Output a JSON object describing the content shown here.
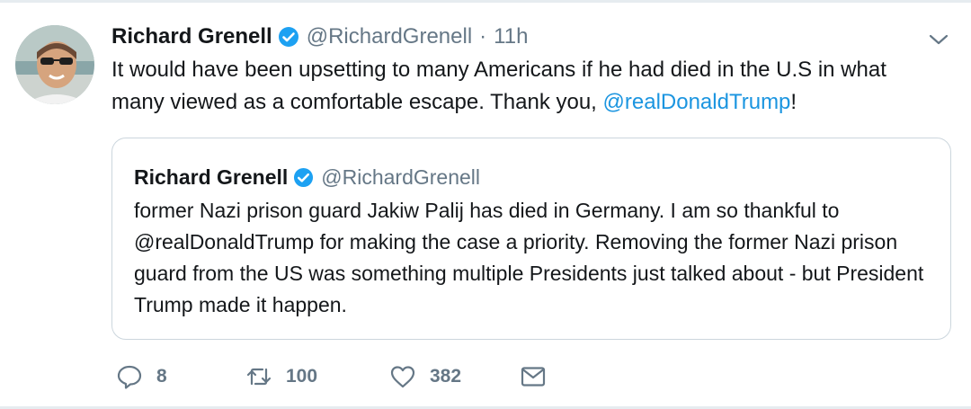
{
  "tweet": {
    "author_name": "Richard Grenell",
    "author_handle": "@RichardGrenell",
    "separator": "·",
    "time": "11h",
    "text_before_mention": "It would have been upsetting to many Americans if he had died in the U.S in what many viewed as a comfortable escape. Thank you, ",
    "mention": "@realDonaldTrump",
    "text_after_mention": "!"
  },
  "quoted_tweet": {
    "author_name": "Richard Grenell",
    "author_handle": "@RichardGrenell",
    "text": "former Nazi prison guard Jakiw Palij has died in Germany. I am so thankful to @realDonaldTrump for making the case a priority. Removing the former Nazi prison guard from the US was something multiple Presidents just talked about - but President Trump made it happen."
  },
  "actions": {
    "reply_count": "8",
    "retweet_count": "100",
    "like_count": "382"
  },
  "icons": {
    "verified": "verified-badge-icon",
    "menu": "chevron-down-icon",
    "reply": "reply-icon",
    "retweet": "retweet-icon",
    "like": "heart-icon",
    "dm": "envelope-icon"
  },
  "colors": {
    "accent": "#1b95e0",
    "verified": "#1da1f2",
    "secondary_text": "#657786",
    "border": "#ccd6dd"
  }
}
